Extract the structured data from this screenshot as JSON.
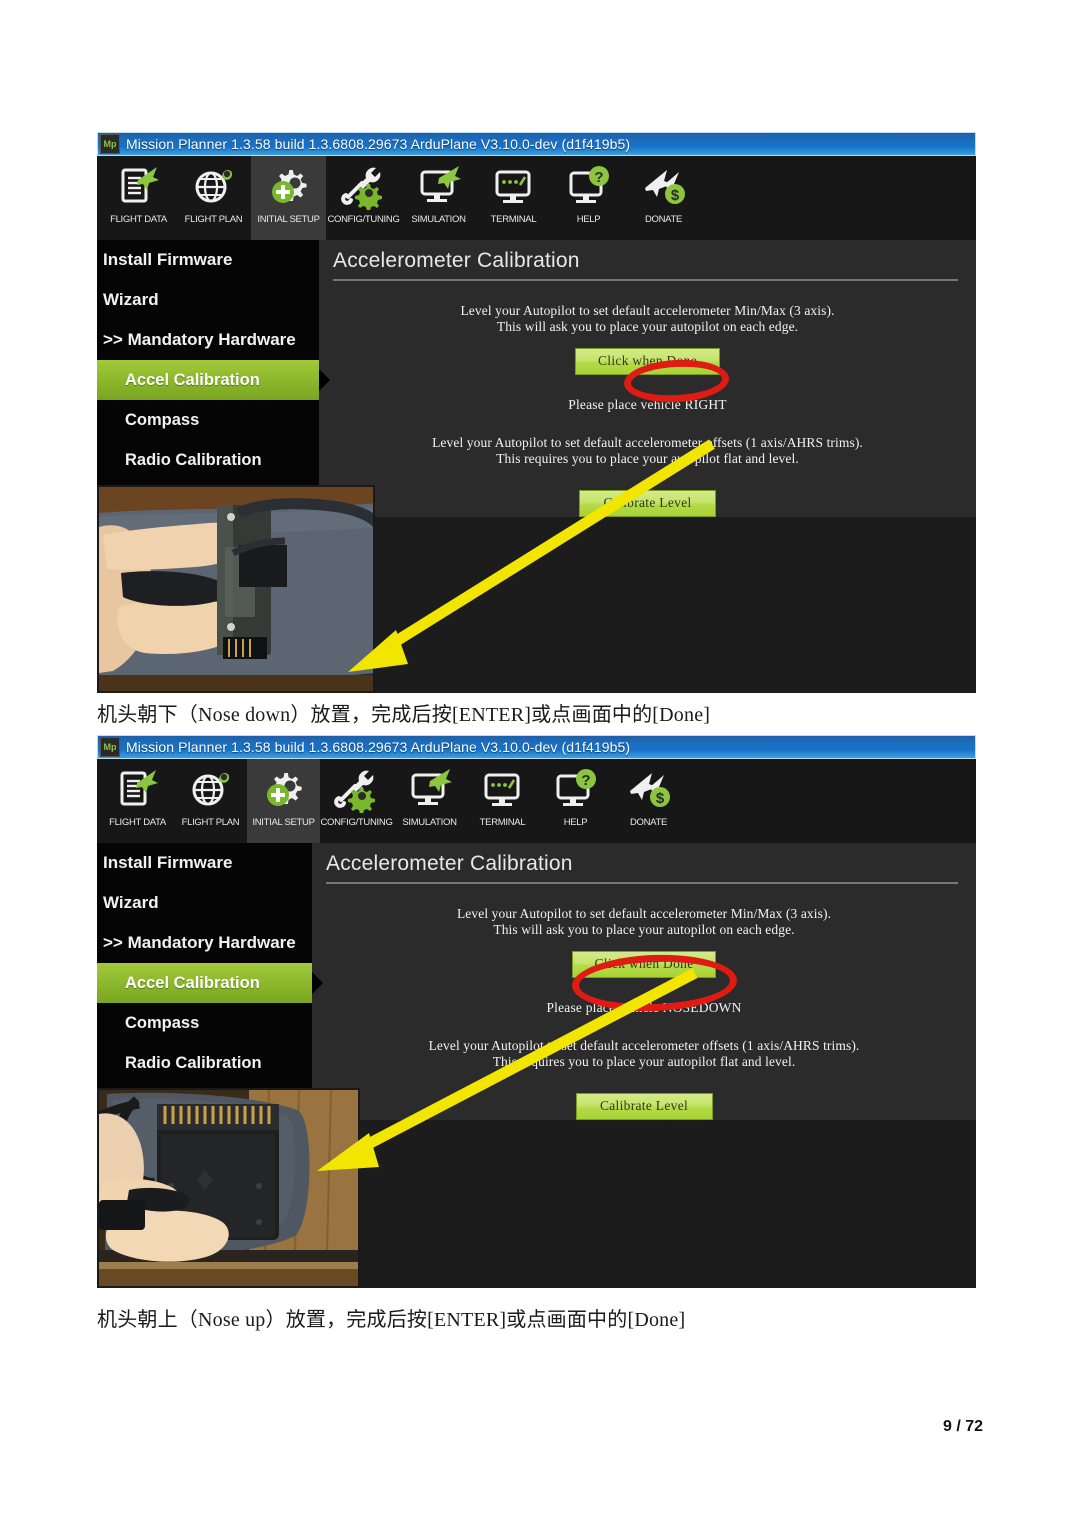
{
  "document": {
    "page_label": "9 / 72",
    "captions": [
      "机头朝下（Nose down）放置，完成后按[ENTER]或点画面中的[Done]",
      "机头朝上（Nose up）放置，完成后按[ENTER]或点画面中的[Done]"
    ]
  },
  "colors": {
    "accent_green": "#8cb82c",
    "button_green": "#b4da48",
    "annotation_red": "#e01b14",
    "annotation_yellow": "#f2e500",
    "titlebar_blue": "#1b6fc0",
    "window_dark": "#2b2b2b",
    "sidebar_black": "#050505"
  },
  "window": {
    "title": "Mission Planner 1.3.58 build 1.3.6808.29673 ArduPlane V3.10.0-dev (d1f419b5)",
    "app_icon": "mission-planner-icon",
    "toolbar": [
      {
        "label": "FLIGHT DATA",
        "icon": "flight-data-icon",
        "active": false
      },
      {
        "label": "FLIGHT PLAN",
        "icon": "flight-plan-icon",
        "active": false
      },
      {
        "label": "INITIAL SETUP",
        "icon": "initial-setup-icon",
        "active": true
      },
      {
        "label": "CONFIG/TUNING",
        "icon": "config-tuning-icon",
        "active": false
      },
      {
        "label": "SIMULATION",
        "icon": "simulation-icon",
        "active": false
      },
      {
        "label": "TERMINAL",
        "icon": "terminal-icon",
        "active": false
      },
      {
        "label": "HELP",
        "icon": "help-icon",
        "active": false
      },
      {
        "label": "DONATE",
        "icon": "donate-icon",
        "active": false
      }
    ],
    "sidebar": [
      {
        "label": "Install Firmware",
        "indent": false,
        "selected": false
      },
      {
        "label": "Wizard",
        "indent": false,
        "selected": false
      },
      {
        "label": ">> Mandatory Hardware",
        "indent": false,
        "selected": false
      },
      {
        "label": "Accel Calibration",
        "indent": true,
        "selected": true
      },
      {
        "label": "Compass",
        "indent": true,
        "selected": false
      },
      {
        "label": "Radio Calibration",
        "indent": true,
        "selected": false
      }
    ],
    "content": {
      "title": "Accelerometer Calibration",
      "minmax_line1": "Level your Autopilot to set default accelerometer Min/Max (3 axis).",
      "minmax_line2": "This will ask you to place your autopilot on each edge.",
      "done_button": "Click when Done",
      "offsets_line1": "Level your Autopilot to set default accelerometer offsets (1 axis/AHRS trims).",
      "offsets_line2": "This requires you to place your autopilot flat and level.",
      "calibrate_button": "Calibrate Level"
    }
  },
  "screenshots": [
    {
      "id": "screenshot-right",
      "place_prompt": "Please place vehicle RIGHT",
      "annotation_circle_target": "vehicle RIGHT",
      "photo_caption_alt": "hand holding autopilot on its right edge"
    },
    {
      "id": "screenshot-nosedown",
      "place_prompt": "Please place vehicle NOSEDOWN",
      "annotation_circle_target": "vehicle NOSEDOWN",
      "photo_caption_alt": "hand holding autopilot nose down on desk"
    }
  ]
}
